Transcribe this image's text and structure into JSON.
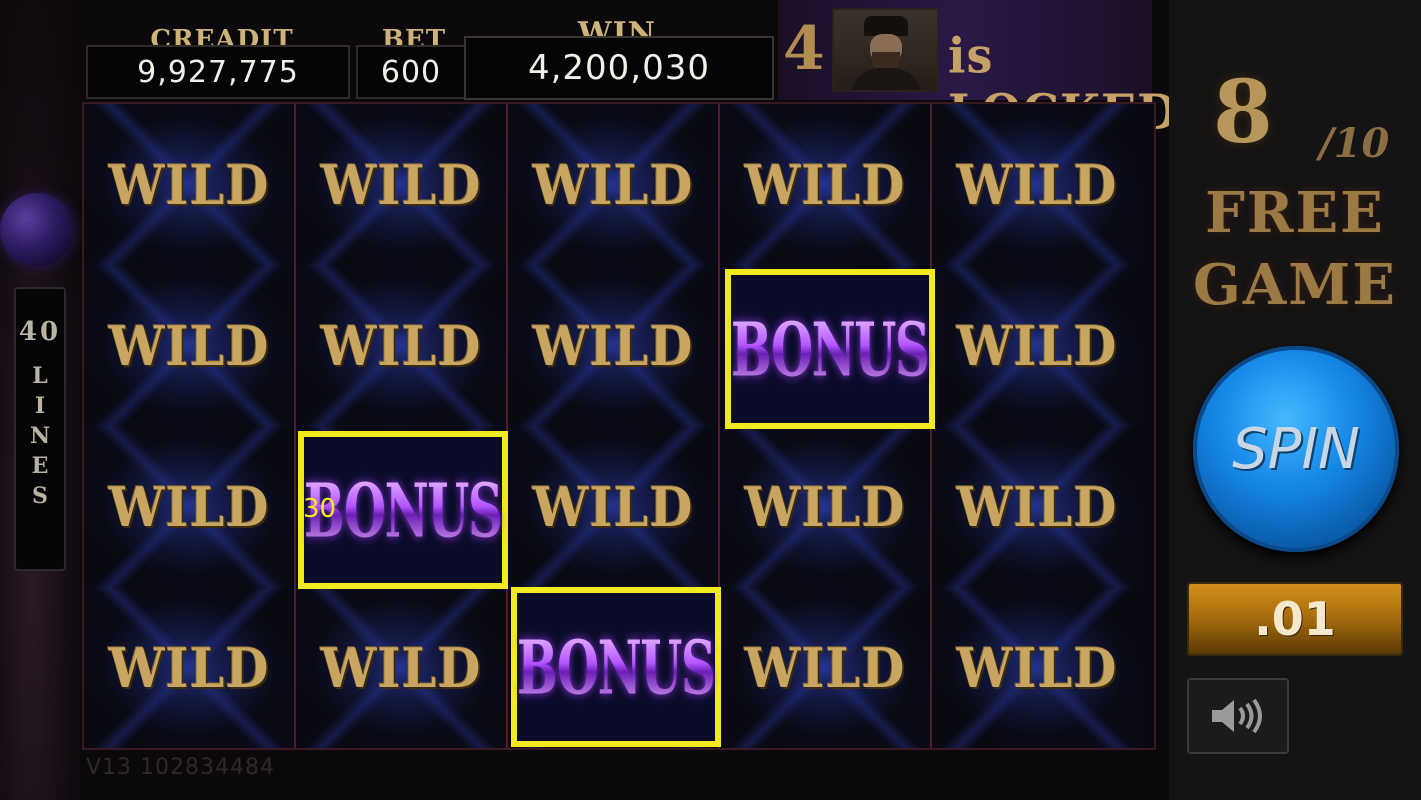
{
  "header": {
    "credit_label": "CREADIT",
    "credit_value": "9,927,775",
    "bet_label": "BET",
    "bet_value": "600",
    "win_label": "WIN",
    "win_value": "4,200,030"
  },
  "locked_banner": {
    "number": "4",
    "text": "is LOCKED!"
  },
  "lines_panel": {
    "count": "40",
    "letters": [
      "L",
      "I",
      "N",
      "E",
      "S"
    ]
  },
  "reels": {
    "rows": [
      [
        "WILD",
        "WILD",
        "WILD",
        "WILD",
        "WILD"
      ],
      [
        "WILD",
        "WILD",
        "WILD",
        "BONUS",
        "WILD"
      ],
      [
        "WILD",
        "BONUS",
        "WILD",
        "WILD",
        "WILD"
      ],
      [
        "WILD",
        "WILD",
        "BONUS",
        "WILD",
        "WILD"
      ]
    ],
    "highlight_color": "#f1ea1e",
    "payout_label": "30"
  },
  "free_game": {
    "current": "8",
    "total": "/10",
    "label_line1": "FREE",
    "label_line2": "GAME"
  },
  "controls": {
    "spin_label": "SPIN",
    "denomination": ".01",
    "sound_icon": "speaker-icon"
  },
  "footer": {
    "version": "V13   102834484"
  },
  "colors": {
    "gold": "#c8a560",
    "spin_blue": "#1486e6",
    "denom_orange": "#d4901a"
  }
}
